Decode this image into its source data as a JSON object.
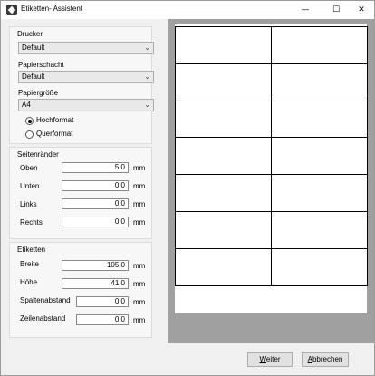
{
  "window": {
    "title": "Etiketten- Assistent",
    "controls": {
      "minimize": "—",
      "maximize": "☐",
      "close": "✕"
    }
  },
  "printer_group": {
    "title": "Drucker",
    "printer_value": "Default",
    "tray_label": "Papierschacht",
    "tray_value": "Default",
    "size_label": "Papiergröße",
    "size_value": "A4",
    "orientation": {
      "portrait_label": "Hochformat",
      "landscape_label": "Querformat",
      "selected": "Hochformat"
    }
  },
  "margins_group": {
    "title": "Seitenränder",
    "fields": [
      {
        "label": "Oben",
        "value": "5,0",
        "unit": "mm"
      },
      {
        "label": "Unten",
        "value": "0,0",
        "unit": "mm"
      },
      {
        "label": "Links",
        "value": "0,0",
        "unit": "mm"
      },
      {
        "label": "Rechts",
        "value": "0,0",
        "unit": "mm"
      }
    ]
  },
  "labels_group": {
    "title": "Etiketten",
    "fields": [
      {
        "label": "Breite",
        "value": "105,0",
        "unit": "mm"
      },
      {
        "label": "Höhe",
        "value": "41,0",
        "unit": "mm"
      },
      {
        "label": "Spaltenabstand",
        "value": "0,0",
        "unit": "mm"
      },
      {
        "label": "Zeilenabstand",
        "value": "0,0",
        "unit": "mm"
      }
    ]
  },
  "preview": {
    "columns": 2,
    "rows": 7
  },
  "buttons": {
    "next_prefix": "",
    "next_mnemonic": "W",
    "next_rest": "eiter",
    "cancel_prefix": "",
    "cancel_mnemonic": "A",
    "cancel_rest": "bbrechen"
  },
  "colors": {
    "preview_background": "#a0a0a0",
    "paper": "#ffffff",
    "label_border": "#000000"
  }
}
